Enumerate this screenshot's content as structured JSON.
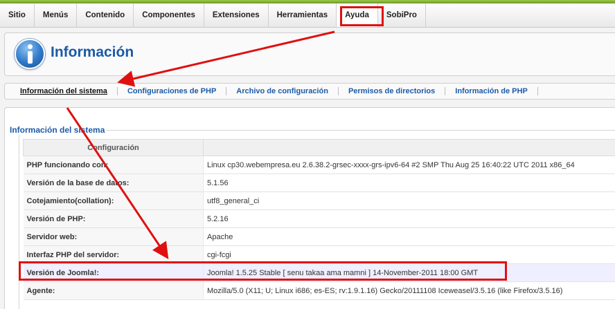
{
  "menu": {
    "items": [
      {
        "label": "Sitio"
      },
      {
        "label": "Menús"
      },
      {
        "label": "Contenido"
      },
      {
        "label": "Componentes"
      },
      {
        "label": "Extensiones"
      },
      {
        "label": "Herramientas"
      },
      {
        "label": "Ayuda",
        "active": true
      },
      {
        "label": "SobiPro"
      }
    ]
  },
  "header": {
    "icon": "info-icon",
    "title": "Información"
  },
  "subnav": {
    "items": [
      {
        "label": "Información del sistema",
        "current": true
      },
      {
        "label": "Configuraciones de PHP"
      },
      {
        "label": "Archivo de configuración"
      },
      {
        "label": "Permisos de directorios"
      },
      {
        "label": "Información de PHP"
      }
    ]
  },
  "system_info": {
    "legend": "Información del sistema",
    "column_header": "Configuración",
    "rows": [
      {
        "key": "PHP funcionando con:",
        "value": "Linux cp30.webempresa.eu 2.6.38.2-grsec-xxxx-grs-ipv6-64 #2 SMP Thu Aug 25 16:40:22 UTC 2011 x86_64"
      },
      {
        "key": "Versión de la base de datos:",
        "value": "5.1.56"
      },
      {
        "key": "Cotejamiento(collation):",
        "value": "utf8_general_ci"
      },
      {
        "key": "Versión de PHP:",
        "value": "5.2.16"
      },
      {
        "key": "Servidor web:",
        "value": "Apache"
      },
      {
        "key": "Interfaz PHP del servidor:",
        "value": "cgi-fcgi"
      },
      {
        "key": "Versión de Joomla!:",
        "value": "Joomla! 1.5.25 Stable [ senu takaa ama mamni ] 14-November-2011 18:00 GMT",
        "highlighted": true
      },
      {
        "key": "Agente:",
        "value": "Mozilla/5.0 (X11; U; Linux i686; es-ES; rv:1.9.1.16) Gecko/20111108 Iceweasel/3.5.16 (like Firefox/3.5.16)"
      }
    ]
  },
  "colors": {
    "accent_blue": "#1c5aa7",
    "annotation_red": "#e01010",
    "top_stripe": "#7aab32"
  }
}
